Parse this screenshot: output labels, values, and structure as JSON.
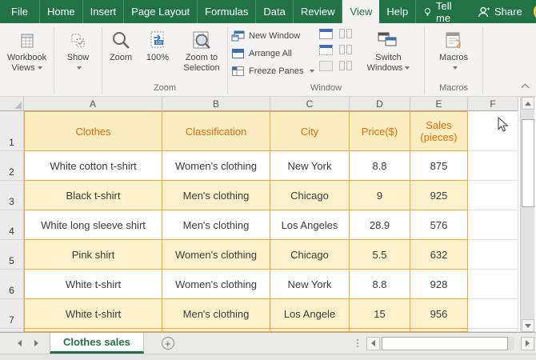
{
  "colors": {
    "excel_green": "#217346",
    "table_border": "#F0A93C",
    "header_text": "#E26B0A",
    "row_yellow": "#FCF1CB"
  },
  "ribbon_tabs": {
    "items": [
      {
        "label": "File",
        "active": false
      },
      {
        "label": "Home",
        "active": false
      },
      {
        "label": "Insert",
        "active": false
      },
      {
        "label": "Page Layout",
        "active": false
      },
      {
        "label": "Formulas",
        "active": false
      },
      {
        "label": "Data",
        "active": false
      },
      {
        "label": "Review",
        "active": false
      },
      {
        "label": "View",
        "active": true
      },
      {
        "label": "Help",
        "active": false
      }
    ],
    "tell_me_label": "Tell me",
    "share_label": "Share"
  },
  "ribbon": {
    "workbook_views_label": "Workbook Views",
    "show_label": "Show",
    "zoom_group": {
      "group_label": "Zoom",
      "zoom_label": "Zoom",
      "zoom_100_label": "100%",
      "zoom_100_badge": "100",
      "zoom_to_selection_label": "Zoom to Selection"
    },
    "window_group": {
      "group_label": "Window",
      "new_window_label": "New Window",
      "arrange_all_label": "Arrange All",
      "freeze_panes_label": "Freeze Panes",
      "switch_windows_label": "Switch Windows"
    },
    "macros_group": {
      "group_label": "Macros",
      "macros_label": "Macros"
    }
  },
  "sheet": {
    "column_headers": [
      "A",
      "B",
      "C",
      "D",
      "E",
      "F"
    ],
    "rows": [
      {
        "num": "1",
        "shade": "header",
        "cells": [
          "Clothes",
          "Classification",
          "City",
          "Price($)",
          "Sales (pieces)"
        ]
      },
      {
        "num": "2",
        "shade": "white",
        "cells": [
          "White cotton t-shirt",
          "Women's clothing",
          "New York",
          "8.8",
          "875"
        ]
      },
      {
        "num": "3",
        "shade": "yellow",
        "cells": [
          "Black t-shirt",
          "Men's clothing",
          "Chicago",
          "9",
          "925"
        ]
      },
      {
        "num": "4",
        "shade": "white",
        "cells": [
          "White long sleeve shirt",
          "Men's clothing",
          "Los Angeles",
          "28.9",
          "576"
        ]
      },
      {
        "num": "5",
        "shade": "yellow",
        "cells": [
          "Pink shirt",
          "Women's clothing",
          "Chicago",
          "5.5",
          "632"
        ]
      },
      {
        "num": "6",
        "shade": "white",
        "cells": [
          "White t-shirt",
          "Women's clothing",
          "New York",
          "8.8",
          "928"
        ]
      },
      {
        "num": "7",
        "shade": "yellow",
        "cells": [
          "White t-shirt",
          "Men's clothing",
          "Los Angele",
          "15",
          "956"
        ]
      }
    ]
  },
  "sheet_bar": {
    "tab_label": "Clothes sales",
    "add_sheet_glyph": "+"
  }
}
